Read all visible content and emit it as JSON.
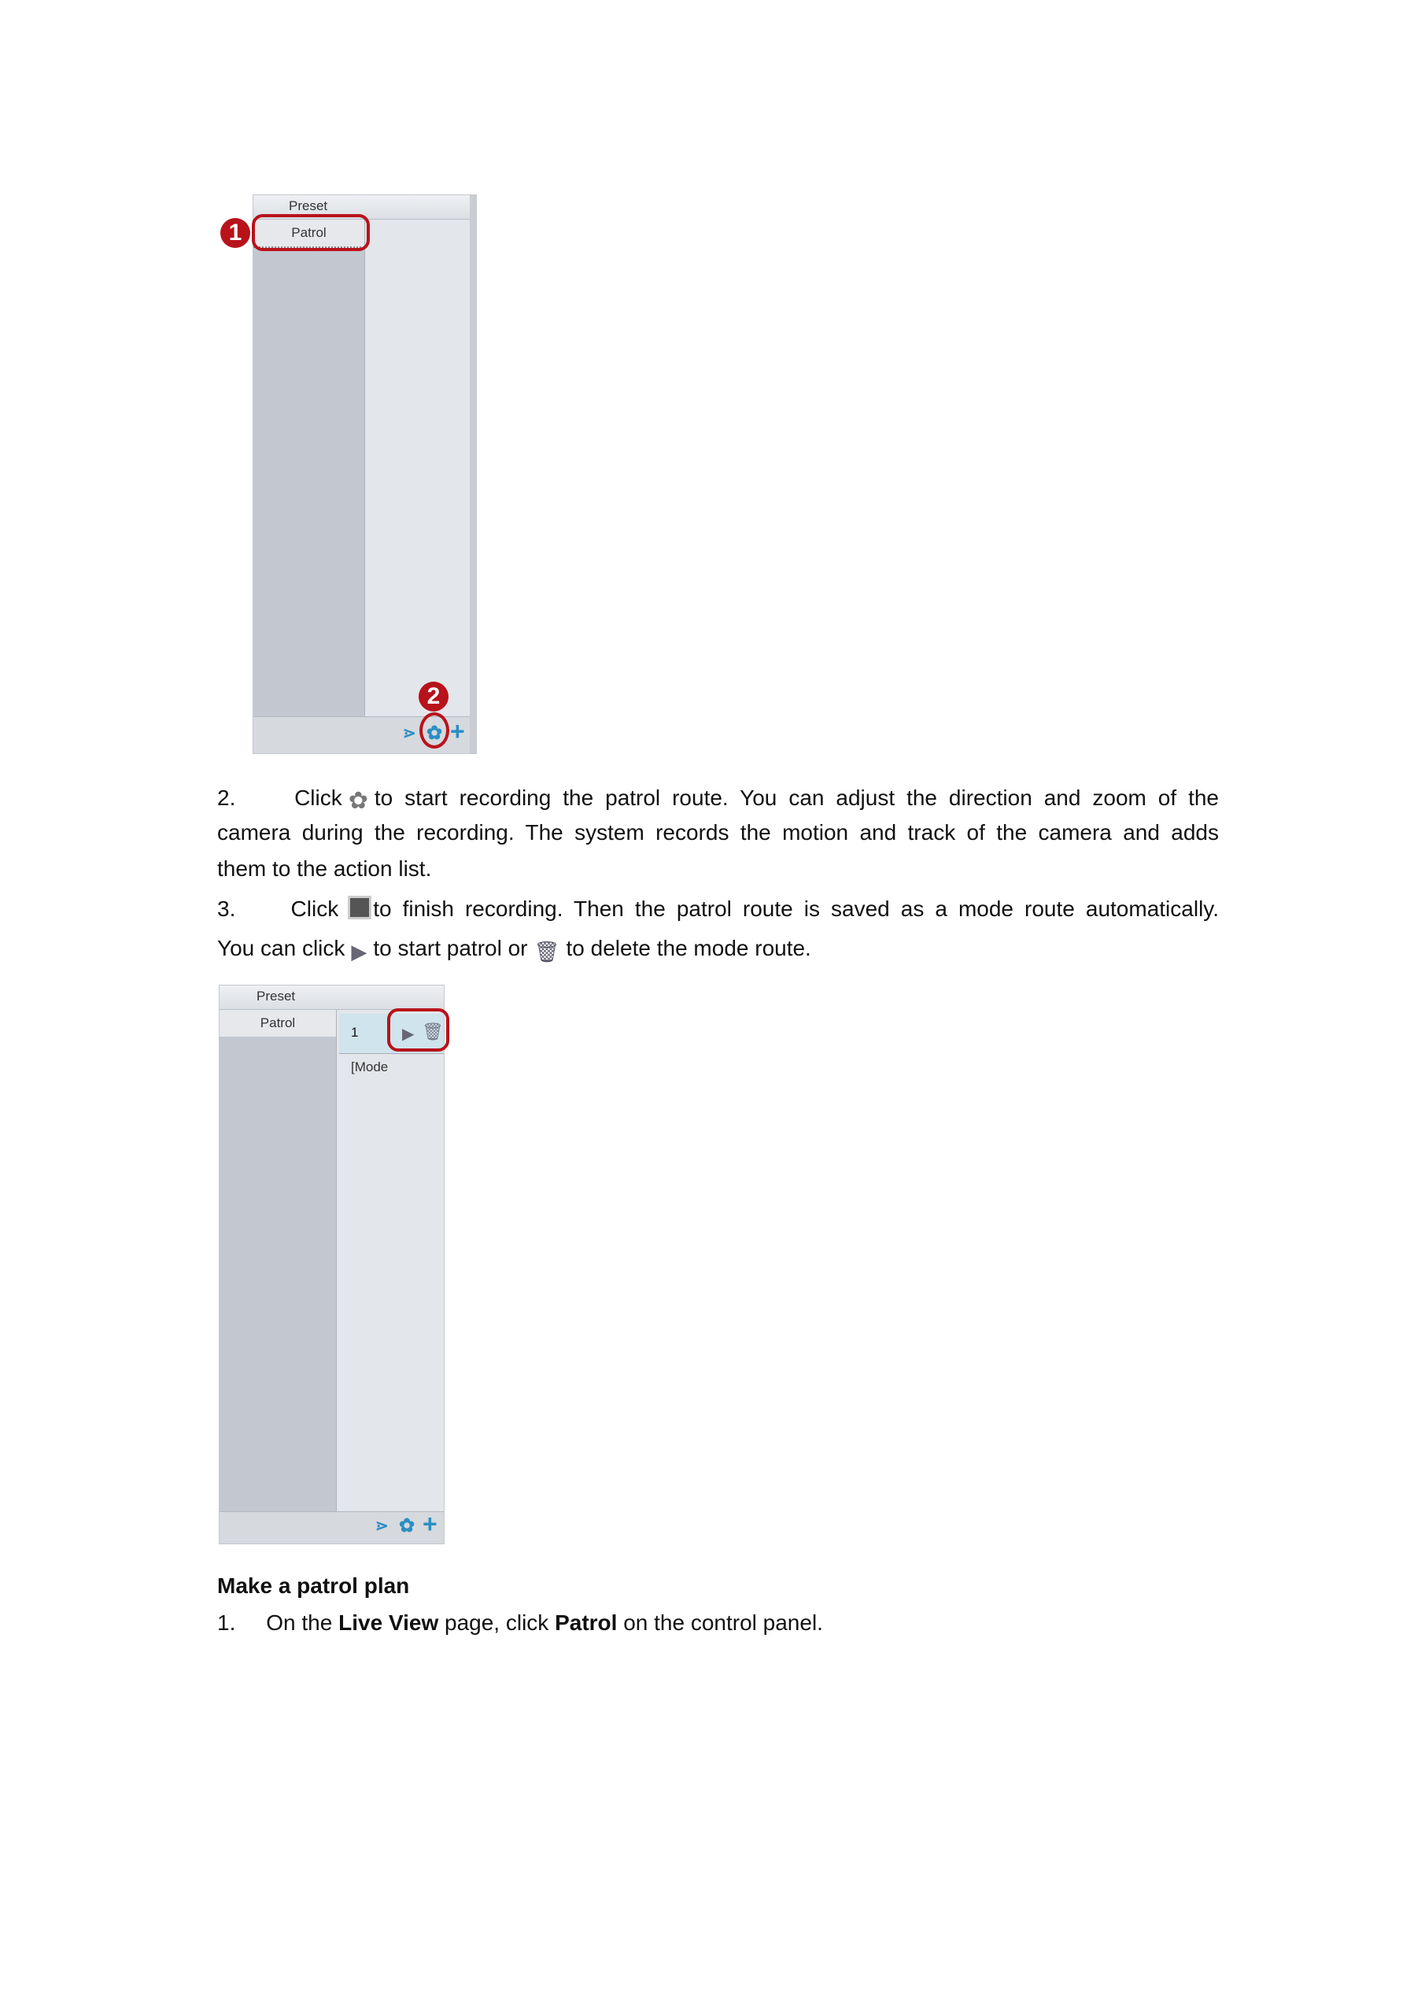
{
  "panel1": {
    "header": "Preset",
    "item": "Patrol",
    "badges": [
      "1",
      "2"
    ],
    "footer_icons": [
      "branch-icon",
      "record-icon",
      "add-icon"
    ]
  },
  "paragraph2": {
    "num": "2.",
    "click": "Click",
    "line1_rest": "to start recording the patrol route. You can adjust the direction and zoom of the",
    "line2": "camera during the recording. The system records the motion and track of the camera and adds",
    "line3": "them to the action list."
  },
  "paragraph3": {
    "num": "3.",
    "click": "Click",
    "line1_rest": "to finish recording. Then the patrol route is saved as a mode route automatically.",
    "line2_a": "You can click",
    "line2_b": "to start patrol or",
    "line2_c": "to delete the mode route."
  },
  "panel2": {
    "header": "Preset",
    "item": "Patrol",
    "route_number": "1",
    "route_type": "[Mode",
    "footer_icons": [
      "branch-icon",
      "record-icon",
      "add-icon"
    ]
  },
  "section": {
    "heading": "Make a patrol plan"
  },
  "step1": {
    "num": "1.",
    "a": "On the",
    "b": "Live View",
    "c": "page, click",
    "d": "Patrol",
    "e": "on the control panel."
  },
  "colors": {
    "accent_red": "#b8121b",
    "icon_blue": "#2a8fc4"
  }
}
